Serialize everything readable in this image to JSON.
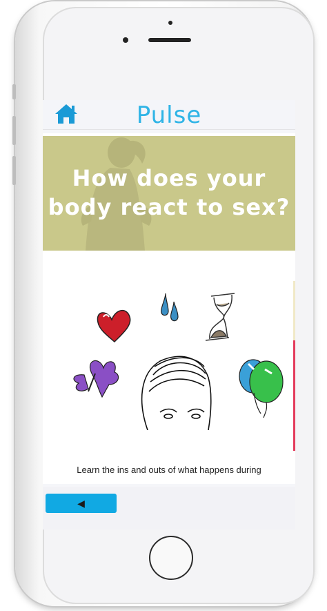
{
  "app": {
    "title": "Pulse"
  },
  "banner": {
    "line1": "How does your",
    "line2": "body react to sex?"
  },
  "content": {
    "caption": "Learn the ins and outs of what happens during"
  },
  "navigation": {
    "back_glyph": "◀"
  },
  "colors": {
    "accent": "#2fb4e6",
    "banner_bg": "#c9c88a",
    "back_button": "#11a9e3"
  },
  "icons": [
    "home-icon",
    "heart-icon",
    "water-drops-icon",
    "hourglass-icon",
    "butterfly-icon",
    "face-sketch-icon",
    "balloons-icon"
  ]
}
